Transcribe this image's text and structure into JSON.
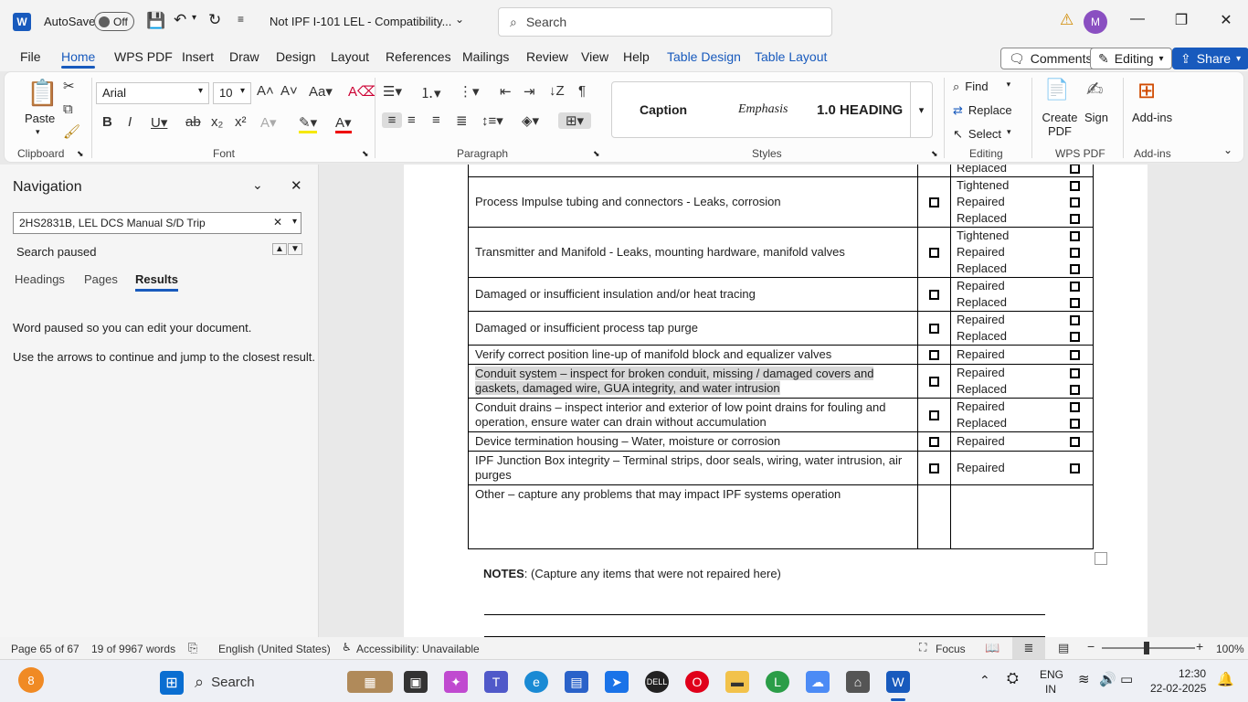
{
  "titlebar": {
    "autosave_label": "AutoSave",
    "autosave_state": "Off",
    "doc_title": "Not IPF I-101 LEL  -  Compatibility...",
    "search_placeholder": "Search",
    "avatar_initial": "M"
  },
  "tabs": [
    "File",
    "Home",
    "WPS PDF",
    "Insert",
    "Draw",
    "Design",
    "Layout",
    "References",
    "Mailings",
    "Review",
    "View",
    "Help",
    "Table Design",
    "Table Layout"
  ],
  "tab_buttons": {
    "comments": "Comments",
    "editing": "Editing",
    "share": "Share"
  },
  "ribbon": {
    "paste": "Paste",
    "font_name": "Arial",
    "font_size": "10",
    "groups": {
      "clipboard": "Clipboard",
      "font": "Font",
      "paragraph": "Paragraph",
      "styles": "Styles",
      "editing": "Editing",
      "wps_pdf": "WPS PDF",
      "addins": "Add-ins"
    },
    "styles": [
      "Caption",
      "Emphasis",
      "1.0  HEADING"
    ],
    "editing_items": [
      "Find",
      "Replace",
      "Select"
    ],
    "create_pdf": "Create PDF",
    "sign": "Sign",
    "addins_btn": "Add-ins"
  },
  "navigation": {
    "title": "Navigation",
    "search_value": "2HS2831B, LEL DCS Manual S/D Trip",
    "search_status": "Search paused",
    "tabs": [
      "Headings",
      "Pages",
      "Results"
    ],
    "message1": "Word paused so you can edit your document.",
    "message2": "Use the arrows to continue and jump to the closest result."
  },
  "document": {
    "rows": [
      {
        "text": "",
        "options": [
          "Replaced"
        ],
        "has_box": false
      },
      {
        "text": "Process Impulse tubing and connectors - Leaks, corrosion",
        "options": [
          "Tightened",
          "Repaired",
          "Replaced"
        ],
        "has_box": true
      },
      {
        "text": "Transmitter and Manifold - Leaks, mounting hardware, manifold valves",
        "options": [
          "Tightened",
          "Repaired",
          "Replaced"
        ],
        "has_box": true
      },
      {
        "text": "Damaged or insufficient insulation and/or heat tracing",
        "options": [
          "Repaired",
          "Replaced"
        ],
        "has_box": true
      },
      {
        "text": "Damaged or insufficient process tap purge",
        "options": [
          "Repaired",
          "Replaced"
        ],
        "has_box": true
      },
      {
        "text": "Verify correct position line-up of manifold block and equalizer valves",
        "options": [
          "Repaired"
        ],
        "has_box": true
      },
      {
        "text": "Conduit system – inspect for broken conduit, missing / damaged covers and gaskets, damaged wire, GUA integrity, and water intrusion",
        "options": [
          "Repaired",
          "Replaced"
        ],
        "has_box": true,
        "highlight": true
      },
      {
        "text": "Conduit drains – inspect interior and exterior of low point drains for fouling and operation, ensure water can drain without accumulation",
        "options": [
          "Repaired",
          "Replaced"
        ],
        "has_box": true
      },
      {
        "text": "Device termination housing – Water, moisture or corrosion",
        "options": [
          "Repaired"
        ],
        "has_box": true
      },
      {
        "text": "IPF Junction Box integrity – Terminal strips, door seals, wiring, water intrusion, air purges",
        "options": [
          "Repaired"
        ],
        "has_box": true
      },
      {
        "text": "Other – capture any problems that may impact IPF systems operation",
        "options": [],
        "has_box": false,
        "tall": true
      }
    ],
    "notes_label": "NOTES",
    "notes_text": ":  (Capture any items that were not repaired here)"
  },
  "status": {
    "page": "Page 65 of 67",
    "words": "19 of 9967 words",
    "language": "English (United States)",
    "accessibility": "Accessibility: Unavailable",
    "focus": "Focus",
    "zoom": "100%"
  },
  "taskbar": {
    "weather_badge": "8",
    "search": "Search",
    "lang": "ENG",
    "region": "IN",
    "time": "12:30",
    "date": "22-02-2025",
    "chrome_badge": "L"
  }
}
